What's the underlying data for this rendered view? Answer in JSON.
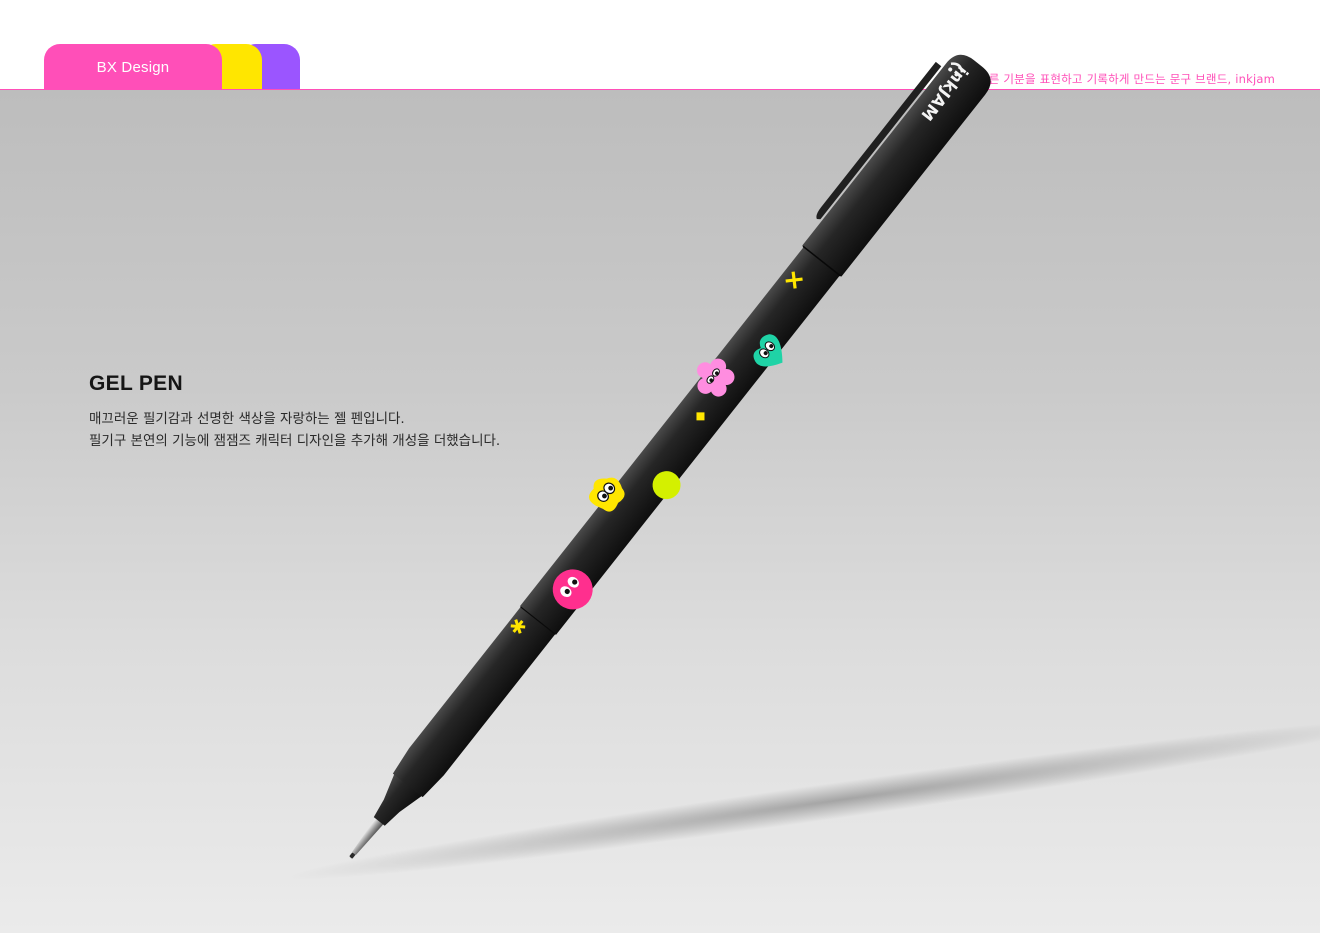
{
  "header": {
    "tab_label": "BX Design",
    "tagline": "매번 다른 기분을 표현하고 기록하게 만드는 문구 브랜드, inkjam",
    "colors": {
      "pink": "#ff4fb8",
      "yellow": "#ffe600",
      "purple": "#9b55ff",
      "tagline": "#ff4fb8"
    }
  },
  "product": {
    "title": "GEL PEN",
    "description_line1": "매끄러운 필기감과 선명한 색상을 자랑하는 젤 펜입니다.",
    "description_line2": "필기구 본연의 기능에 잼잼즈 캐릭터 디자인을 추가해 개성을 더했습니다."
  },
  "pen": {
    "brand_mark": "inkJAM",
    "body_color": "#1c1c1c",
    "character_colors": [
      "#ff2f8e",
      "#ffe600",
      "#ff8de0",
      "#1fd3a6",
      "#d4f000"
    ]
  }
}
